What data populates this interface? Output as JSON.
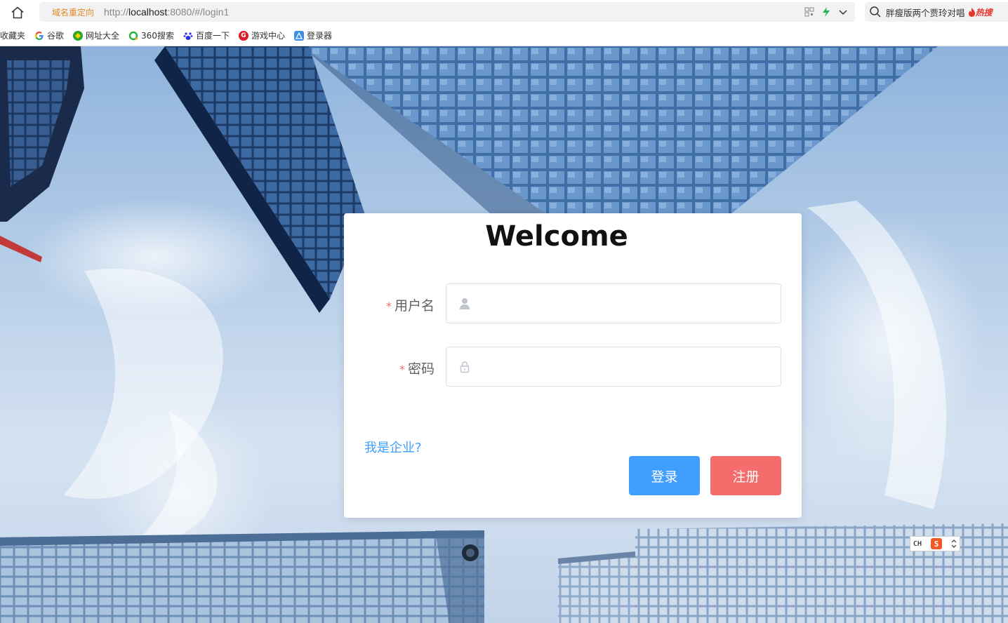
{
  "browser": {
    "redirect_tag": "域名重定向",
    "url_scheme": "http://",
    "url_host": "localhost",
    "url_rest": ":8080/#/login1",
    "search_hot_text": "胖瘦版两个贾玲对唱",
    "hot_badge": "热搜"
  },
  "bookmarks": [
    {
      "label": "收藏夹",
      "icon": "none",
      "color": ""
    },
    {
      "label": "谷歌",
      "icon": "google-icon",
      "color": "#4285f4"
    },
    {
      "label": "网址大全",
      "icon": "navigation-icon",
      "color": "#2aa82a"
    },
    {
      "label": "360搜索",
      "icon": "search-360-icon",
      "color": "#1fb342"
    },
    {
      "label": "百度一下",
      "icon": "baidu-paw-icon",
      "color": "#2932e1"
    },
    {
      "label": "游戏中心",
      "icon": "game-icon",
      "color": "#d81e2a"
    },
    {
      "label": "登录器",
      "icon": "launcher-icon",
      "color": "#3a8ee6"
    }
  ],
  "login": {
    "title": "Welcome",
    "username_label": "用户名",
    "password_label": "密码",
    "required_mark": "*",
    "username_value": "",
    "password_value": "",
    "enterprise_link": "我是企业?",
    "login_button": "登录",
    "register_button": "注册"
  },
  "ime": {
    "lang": "CH",
    "logo": "S"
  },
  "colors": {
    "primary": "#409eff",
    "danger": "#f56c6c",
    "label": "#606266",
    "border": "#dcdfe6",
    "redirect": "#e8861c",
    "hot": "#e8352a"
  }
}
